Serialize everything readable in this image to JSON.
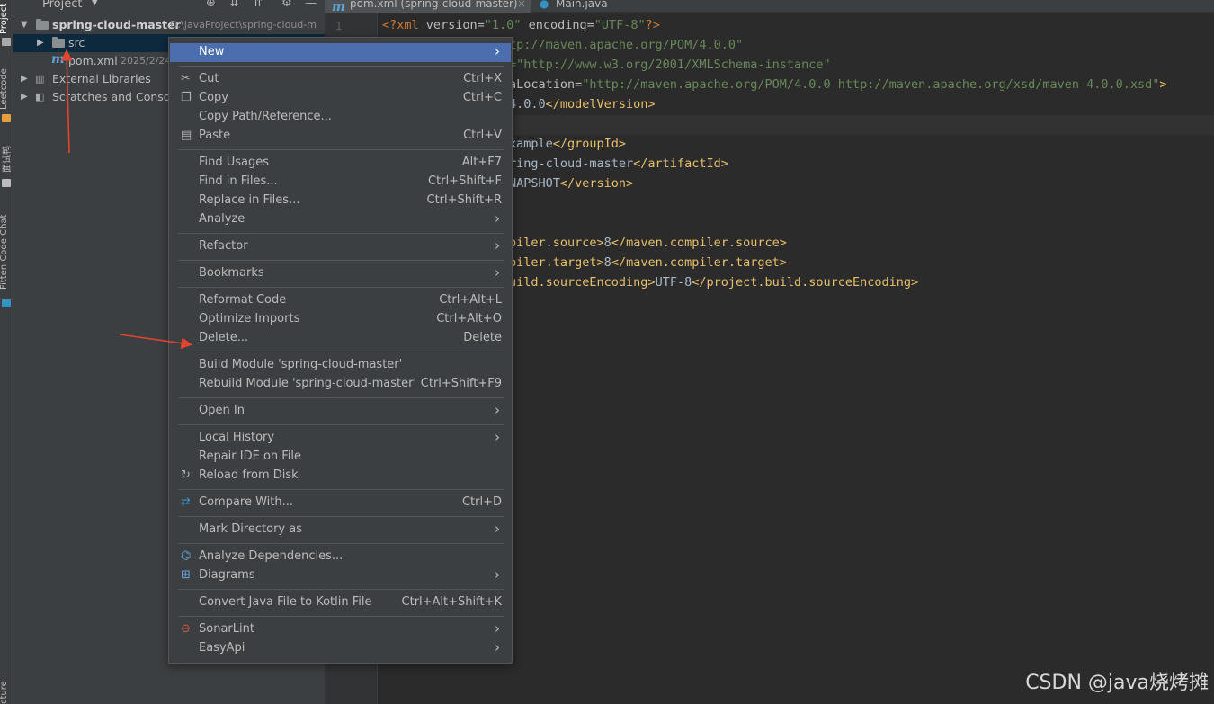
{
  "tool_strip": {
    "project_label": "Project",
    "leetcode_label": "Leetcode",
    "interview_label": "面试鸭",
    "fitten_label": "Fitten Code Chat",
    "structure_label": "cture"
  },
  "project_panel": {
    "title": "Project",
    "tree": {
      "root_name": "spring-cloud-master",
      "root_path": "D:\\javaProject\\spring-cloud-m",
      "src_label": "src",
      "pom_label": "pom.xml",
      "pom_date": "2025/2/24",
      "external_libs_label": "External Libraries",
      "scratches_label": "Scratches and Consoles"
    }
  },
  "editor": {
    "tabs": [
      {
        "label": "pom.xml (spring-cloud-master)",
        "icon": "maven-icon"
      },
      {
        "label": "Main.java",
        "icon": "java-class-icon"
      }
    ],
    "line_number": "1",
    "code": {
      "l1": {
        "pi_open": "<?",
        "name": "xml",
        "attr1": " version=",
        "val1": "\"1.0\"",
        "attr2": " encoding=",
        "val2": "\"UTF-8\"",
        "pi_close": "?>"
      },
      "l2": {
        "val": "tp://maven.apache.org/POM/4.0.0\""
      },
      "l3": {
        "val": "=\"http://www.w3.org/2001/XMLSchema-instance\""
      },
      "l4": {
        "attr": "aLocation=",
        "val": "\"http://maven.apache.org/POM/4.0.0 http://maven.apache.org/xsd/maven-4.0.0.xsd\"",
        "close": ">"
      },
      "l5": {
        "text": "4.0.0",
        "close_tag": "</modelVersion>"
      },
      "l6": {
        "text": "xample",
        "close_tag": "</groupId>"
      },
      "l7": {
        "text": "ring-cloud-master",
        "close_tag": "</artifactId>"
      },
      "l8": {
        "text": "NAPSHOT",
        "close_tag": "</version>"
      },
      "l9": {
        "tag": "piler.source>",
        "text": "8",
        "close_tag": "</maven.compiler.source>"
      },
      "l10": {
        "tag": "piler.target>",
        "text": "8",
        "close_tag": "</maven.compiler.target>"
      },
      "l11": {
        "tag": "uild.sourceEncoding>",
        "text": "UTF-8",
        "close_tag": "</project.build.sourceEncoding>"
      }
    }
  },
  "context_menu": {
    "new": "New",
    "cut": "Cut",
    "cut_sc": "Ctrl+X",
    "copy": "Copy",
    "copy_sc": "Ctrl+C",
    "copy_path": "Copy Path/Reference...",
    "paste": "Paste",
    "paste_sc": "Ctrl+V",
    "find_usages": "Find Usages",
    "find_usages_sc": "Alt+F7",
    "find_in_files": "Find in Files...",
    "find_in_files_sc": "Ctrl+Shift+F",
    "replace_in_files": "Replace in Files...",
    "replace_in_files_sc": "Ctrl+Shift+R",
    "analyze": "Analyze",
    "refactor": "Refactor",
    "bookmarks": "Bookmarks",
    "reformat_code": "Reformat Code",
    "reformat_code_sc": "Ctrl+Alt+L",
    "optimize_imports": "Optimize Imports",
    "optimize_imports_sc": "Ctrl+Alt+O",
    "delete": "Delete...",
    "delete_sc": "Delete",
    "build_module": "Build Module 'spring-cloud-master'",
    "rebuild_module": "Rebuild Module 'spring-cloud-master'",
    "rebuild_module_sc": "Ctrl+Shift+F9",
    "open_in": "Open In",
    "local_history": "Local History",
    "repair_ide": "Repair IDE on File",
    "reload_from_disk": "Reload from Disk",
    "compare_with": "Compare With...",
    "compare_with_sc": "Ctrl+D",
    "mark_directory_as": "Mark Directory as",
    "analyze_dependencies": "Analyze Dependencies...",
    "diagrams": "Diagrams",
    "convert_java": "Convert Java File to Kotlin File",
    "convert_java_sc": "Ctrl+Alt+Shift+K",
    "sonarlint": "SonarLint",
    "easyapi": "EasyApi"
  },
  "watermark": "CSDN @java烧烤摊",
  "colors": {
    "menu_highlight": "#4b6eaf",
    "annotation_arrow": "#e0452f",
    "xml_tag": "#e8bf6a",
    "xml_value": "#6a8759"
  }
}
